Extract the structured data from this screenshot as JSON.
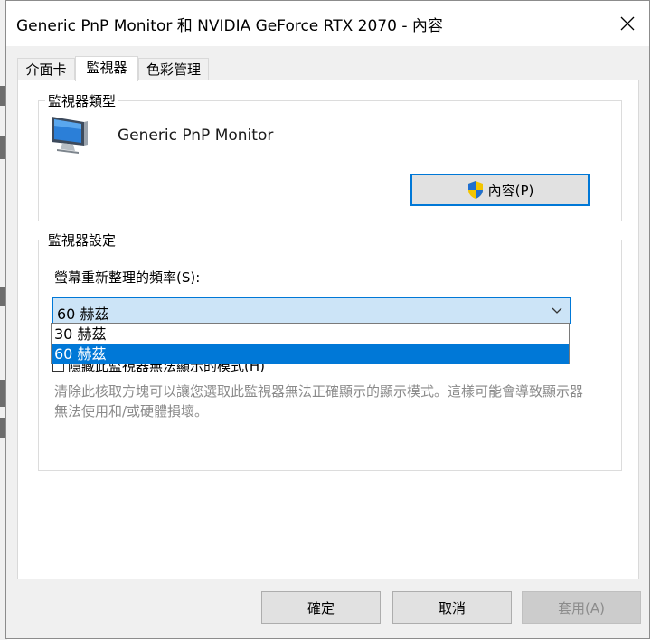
{
  "window": {
    "title": "Generic PnP Monitor 和 NVIDIA GeForce RTX 2070 - 內容"
  },
  "tabs": [
    {
      "label": "介面卡",
      "active": false
    },
    {
      "label": "監視器",
      "active": true
    },
    {
      "label": "色彩管理",
      "active": false
    }
  ],
  "monitor_type": {
    "legend": "監視器類型",
    "monitor_name": "Generic PnP Monitor",
    "properties_button": "內容(P)"
  },
  "monitor_settings": {
    "legend": "監視器設定",
    "refresh_label": "螢幕重新整理的頻率(S):",
    "refresh_selected": "60 赫茲",
    "refresh_options": [
      {
        "label": "30 赫茲",
        "selected": false
      },
      {
        "label": "60 赫茲",
        "selected": true
      }
    ],
    "hide_modes_checkbox_label": "隱藏此監視器無法顯示的模式(H)",
    "description": "清除此核取方塊可以讓您選取此監視器無法正確顯示的顯示模式。這樣可能會導致顯示器無法使用和/或硬體損壞。"
  },
  "buttons": {
    "ok": "確定",
    "cancel": "取消",
    "apply": "套用(A)"
  },
  "colors": {
    "accent": "#0078d7",
    "select_bg": "#cce4f7",
    "disabled_text": "#8c8c8c"
  },
  "icons": {
    "close": "close-icon",
    "monitor": "monitor-icon",
    "shield": "shield-icon",
    "dropdown": "chevron-down-icon"
  }
}
